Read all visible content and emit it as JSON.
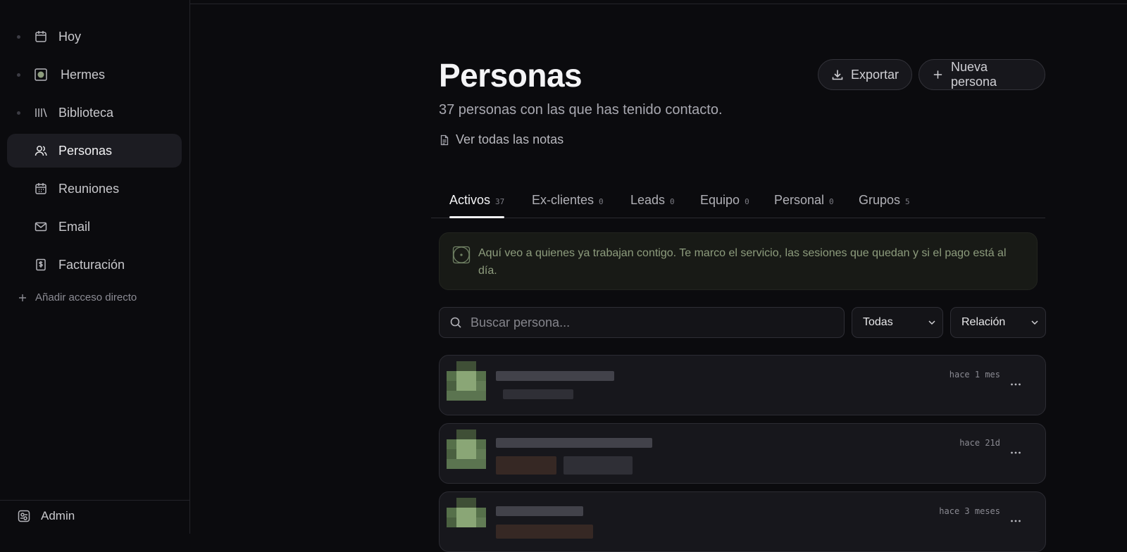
{
  "sidebar": {
    "items": [
      {
        "label": "Hoy",
        "icon": "calendar-icon"
      },
      {
        "label": "Hermes",
        "icon": "hermes-icon"
      },
      {
        "label": "Biblioteca",
        "icon": "library-icon"
      },
      {
        "label": "Personas",
        "icon": "people-icon",
        "active": true
      },
      {
        "label": "Reuniones",
        "icon": "calendar-grid-icon"
      },
      {
        "label": "Email",
        "icon": "mail-icon"
      },
      {
        "label": "Facturación",
        "icon": "invoice-icon"
      }
    ],
    "add_shortcut": "Añadir acceso directo",
    "admin": "Admin"
  },
  "header": {
    "title": "Personas",
    "subtitle": "37 personas con las que has tenido contacto.",
    "notes_link": "Ver todas las notas",
    "export_label": "Exportar",
    "new_label": "Nueva persona"
  },
  "tabs": [
    {
      "label": "Activos",
      "count": "37",
      "active": true
    },
    {
      "label": "Ex-clientes",
      "count": "0"
    },
    {
      "label": "Leads",
      "count": "0"
    },
    {
      "label": "Equipo",
      "count": "0"
    },
    {
      "label": "Personal",
      "count": "0"
    },
    {
      "label": "Grupos",
      "count": "5"
    }
  ],
  "hint": {
    "text": "Aquí veo a quienes ya trabajan contigo. Te marco el servicio, las sesiones que quedan y si el pago está al día."
  },
  "search": {
    "placeholder": "Buscar persona..."
  },
  "filters": {
    "status": "Todas",
    "relation": "Relación"
  },
  "people": [
    {
      "time": "hace 1 mes"
    },
    {
      "time": "hace 21d"
    },
    {
      "time": "hace 3 meses"
    }
  ],
  "colors": {
    "background": "#0b0b0e",
    "accent_green": "#8d9c7d",
    "active_item": "#1c1c22"
  }
}
